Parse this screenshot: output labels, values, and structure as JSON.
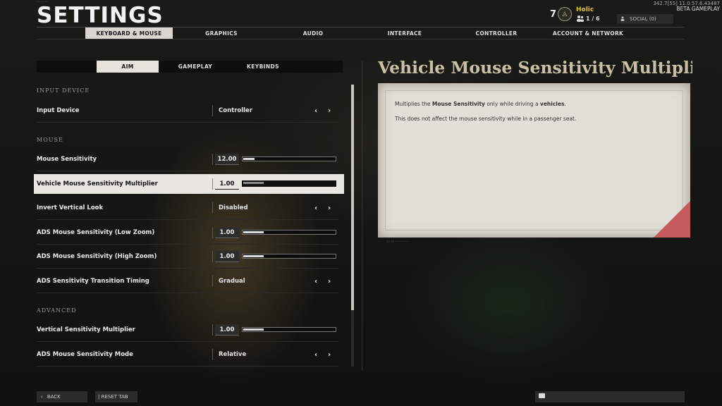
{
  "header": {
    "title": "SETTINGS",
    "build_info": "342.7[55] 11.0.57.6.43487",
    "beta_label": "BETA GAMEPLAY",
    "player": {
      "level": "7",
      "name": "Holic",
      "party": "1 / 6"
    },
    "social_label": "SOCIAL (0)"
  },
  "main_tabs": [
    {
      "label": "KEYBOARD & MOUSE",
      "active": true
    },
    {
      "label": "GRAPHICS"
    },
    {
      "label": "AUDIO"
    },
    {
      "label": "INTERFACE"
    },
    {
      "label": "CONTROLLER"
    },
    {
      "label": "ACCOUNT & NETWORK"
    }
  ],
  "sub_tabs": [
    {
      "label": "AIM",
      "active": true
    },
    {
      "label": "GAMEPLAY"
    },
    {
      "label": "KEYBINDS"
    }
  ],
  "sections": {
    "input_device": "INPUT DEVICE",
    "mouse": "MOUSE",
    "advanced": "ADVANCED"
  },
  "rows": [
    {
      "label": "Input Device",
      "value": "Controller",
      "type": "selector"
    },
    {
      "label": "Mouse Sensitivity",
      "value": "12.00",
      "type": "slider",
      "fill": 0.12
    },
    {
      "label": "Vehicle Mouse Sensitivity Multiplier",
      "value": "1.00",
      "type": "slider",
      "fill": 0.22,
      "selected": true
    },
    {
      "label": "Invert Vertical Look",
      "value": "Disabled",
      "type": "selector"
    },
    {
      "label": "ADS Mouse Sensitivity (Low Zoom)",
      "value": "1.00",
      "type": "slider",
      "fill": 0.22
    },
    {
      "label": "ADS Mouse Sensitivity (High Zoom)",
      "value": "1.00",
      "type": "slider",
      "fill": 0.22
    },
    {
      "label": "ADS Sensitivity Transition Timing",
      "value": "Gradual",
      "type": "selector"
    },
    {
      "label": "Vertical Sensitivity Multiplier",
      "value": "1.00",
      "type": "slider",
      "fill": 0.22
    },
    {
      "label": "ADS Mouse Sensitivity Mode",
      "value": "Relative",
      "type": "selector"
    }
  ],
  "detail": {
    "title": "Vehicle Mouse Sensitivity Multiplier",
    "line1_pre": "Multiplies the ",
    "line1_bold1": "Mouse Sensitivity",
    "line1_mid": " only while driving a ",
    "line1_bold2": "vehicles",
    "line1_end": ".",
    "line2": "This does not affect the mouse sensitivity while in a passenger seat."
  },
  "footer": {
    "back_label": "BACK",
    "reset_label": "| RESET TAB"
  },
  "icons": {
    "prev": "‹",
    "next": "›",
    "back": "‹",
    "party": "👥"
  },
  "colors": {
    "accent_gold": "#e2c23c",
    "title_tan": "#c9bfa4",
    "corner_red": "#c45a5e"
  }
}
